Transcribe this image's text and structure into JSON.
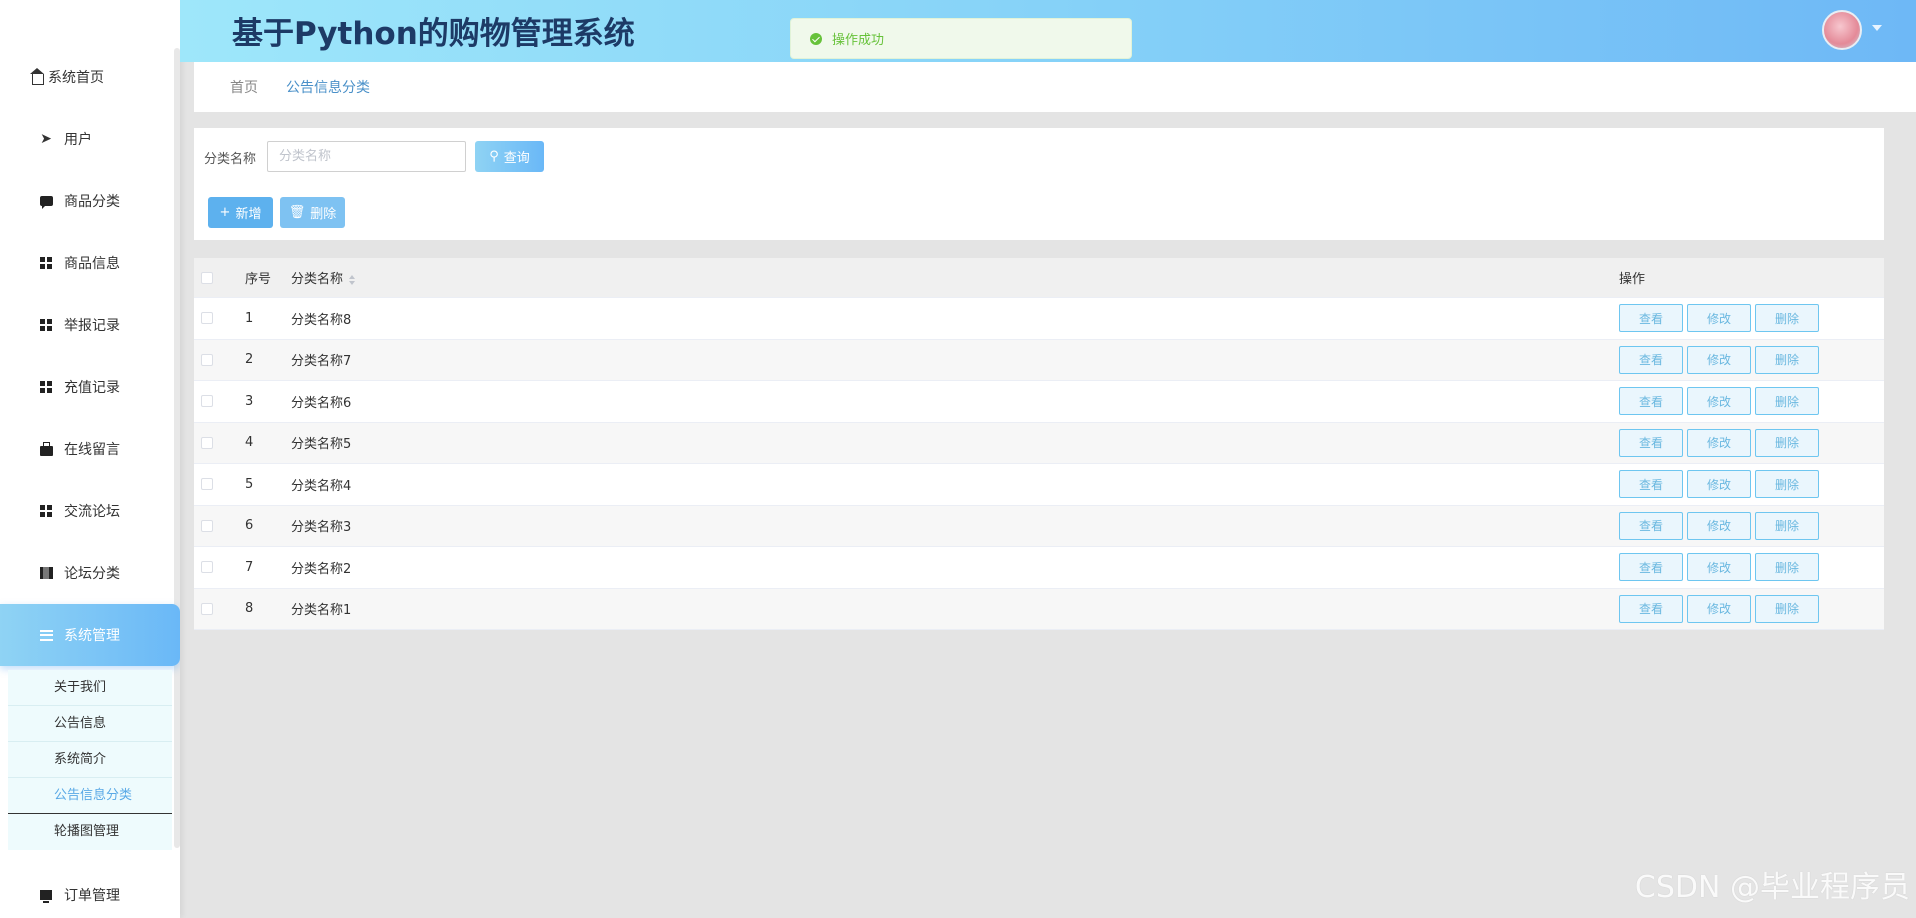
{
  "app": {
    "title": "基于Python的购物管理系统"
  },
  "toast": {
    "message": "操作成功"
  },
  "sidebar": {
    "items": [
      {
        "label": "系统首页",
        "icon": "home-icon"
      },
      {
        "label": "用户",
        "icon": "send-icon"
      },
      {
        "label": "商品分类",
        "icon": "chat-icon"
      },
      {
        "label": "商品信息",
        "icon": "grid-icon"
      },
      {
        "label": "举报记录",
        "icon": "grid-icon"
      },
      {
        "label": "充值记录",
        "icon": "grid-icon"
      },
      {
        "label": "在线留言",
        "icon": "bag-icon"
      },
      {
        "label": "交流论坛",
        "icon": "grid-icon"
      },
      {
        "label": "论坛分类",
        "icon": "book-icon"
      },
      {
        "label": "系统管理",
        "icon": "menu-icon"
      },
      {
        "label": "订单管理",
        "icon": "monitor-icon"
      }
    ],
    "submenu": [
      {
        "label": "关于我们"
      },
      {
        "label": "公告信息"
      },
      {
        "label": "系统简介"
      },
      {
        "label": "公告信息分类"
      },
      {
        "label": "轮播图管理"
      }
    ]
  },
  "breadcrumb": {
    "home": "首页",
    "current": "公告信息分类"
  },
  "search": {
    "label": "分类名称",
    "placeholder": "分类名称",
    "value": "",
    "query_label": "查询",
    "add_label": "新增",
    "delete_label": "删除"
  },
  "table": {
    "headers": {
      "no": "序号",
      "name": "分类名称",
      "ops": "操作"
    },
    "rows": [
      {
        "no": "1",
        "name": "分类名称8"
      },
      {
        "no": "2",
        "name": "分类名称7"
      },
      {
        "no": "3",
        "name": "分类名称6"
      },
      {
        "no": "4",
        "name": "分类名称5"
      },
      {
        "no": "5",
        "name": "分类名称4"
      },
      {
        "no": "6",
        "name": "分类名称3"
      },
      {
        "no": "7",
        "name": "分类名称2"
      },
      {
        "no": "8",
        "name": "分类名称1"
      }
    ],
    "actions": {
      "view": "查看",
      "edit": "修改",
      "delete": "删除"
    }
  },
  "watermark": "CSDN @毕业程序员",
  "colors": {
    "accent": "#6ab8f7",
    "success": "#67c23a",
    "title": "#1d3a66"
  }
}
